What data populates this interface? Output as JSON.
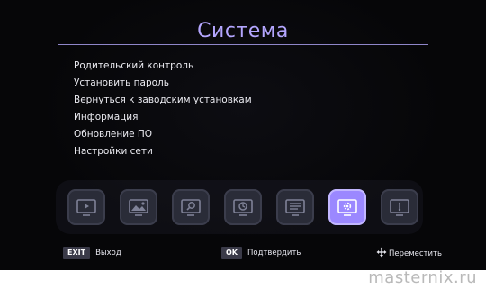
{
  "screen": {
    "title": "Система",
    "menu_items": [
      {
        "label": "Родительский контроль"
      },
      {
        "label": "Установить пароль"
      },
      {
        "label": "Вернуться к заводским установкам"
      },
      {
        "label": "Информация"
      },
      {
        "label": "Обновление ПО"
      },
      {
        "label": "Настройки сети"
      }
    ],
    "icon_bar": [
      {
        "name": "video-icon",
        "selected": false
      },
      {
        "name": "picture-icon",
        "selected": false
      },
      {
        "name": "search-icon",
        "selected": false
      },
      {
        "name": "clock-icon",
        "selected": false
      },
      {
        "name": "list-icon",
        "selected": false
      },
      {
        "name": "gear-icon",
        "selected": true
      },
      {
        "name": "usb-icon",
        "selected": false
      }
    ],
    "colors": {
      "accent": "#9b88ff",
      "title": "#b4a6ff",
      "background": "#060608"
    }
  },
  "footer": {
    "exit_key": "EXIT",
    "exit_label": "Выход",
    "ok_key": "OK",
    "ok_label": "Подтвердить",
    "move_label": "Переместить"
  },
  "watermark": "masternix.ru"
}
